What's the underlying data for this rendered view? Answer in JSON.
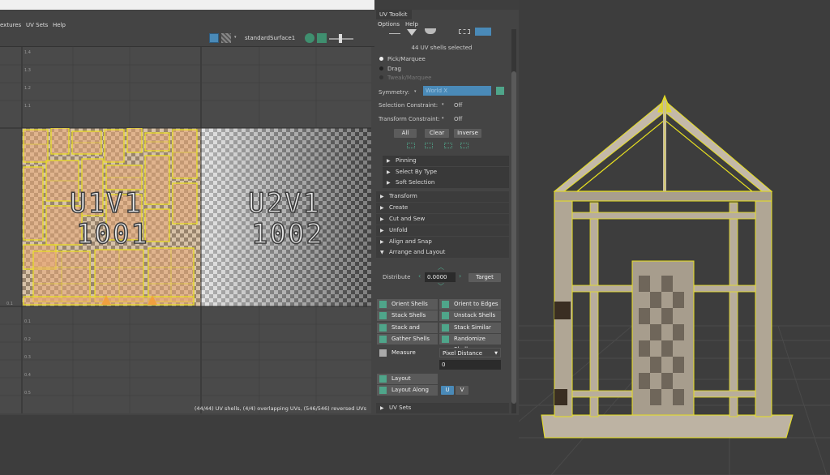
{
  "uv_editor": {
    "menu": [
      "extures",
      "UV Sets",
      "Help"
    ],
    "material_name": "standardSurface1",
    "tile_1": {
      "line1": "U1V1",
      "line2": "1001"
    },
    "tile_2": {
      "line1": "U2V1",
      "line2": "1002"
    },
    "v_ticks": [
      "1.4",
      "1.3",
      "1.2",
      "1.1",
      "0.1",
      "0.1",
      "0.2",
      "0.3",
      "0.4",
      "0.5",
      "0.6",
      "0.7",
      "0.8",
      "0.9"
    ],
    "status_text": "(44/44) UV shells, (4/4) overlapping UVs, (546/546) reversed UVs"
  },
  "toolkit": {
    "tab_title": "UV Toolkit",
    "menu": [
      "Options",
      "Help"
    ],
    "selection_info": "44 UV shells selected",
    "modes": [
      "Pick/Marquee",
      "Drag",
      "Tweak/Marquee"
    ],
    "symmetry_label": "Symmetry:",
    "symmetry_value": "World X",
    "selection_constraint_label": "Selection Constraint:",
    "selection_constraint_value": "Off",
    "transform_constraint_label": "Transform Constraint:",
    "transform_constraint_value": "Off",
    "buttons": {
      "all": "All",
      "clear": "Clear",
      "inverse": "Inverse"
    },
    "sub_sections": [
      "Pinning",
      "Select By Type",
      "Soft Selection"
    ],
    "sections": [
      "Transform",
      "Create",
      "Cut and Sew",
      "Unfold",
      "Align and Snap",
      "Arrange and Layout"
    ],
    "distribute_label": "Distribute",
    "distribute_value": "0.0000",
    "target_label": "Target",
    "tools": [
      [
        "Orient Shells",
        "Orient to Edges"
      ],
      [
        "Stack Shells",
        "Unstack Shells"
      ],
      [
        "Stack and Orient",
        "Stack Similar"
      ],
      [
        "Gather Shells",
        "Randomize Shells"
      ]
    ],
    "measure_label": "Measure",
    "measure_value": "Pixel Distance",
    "measure_result": "0",
    "layout_label": "Layout",
    "layout_along_label": "Layout Along",
    "u_label": "U",
    "v_label": "V",
    "uv_sets_label": "UV Sets"
  },
  "colors": {
    "accent": "#4a8ab8",
    "selection": "#e8e020"
  }
}
